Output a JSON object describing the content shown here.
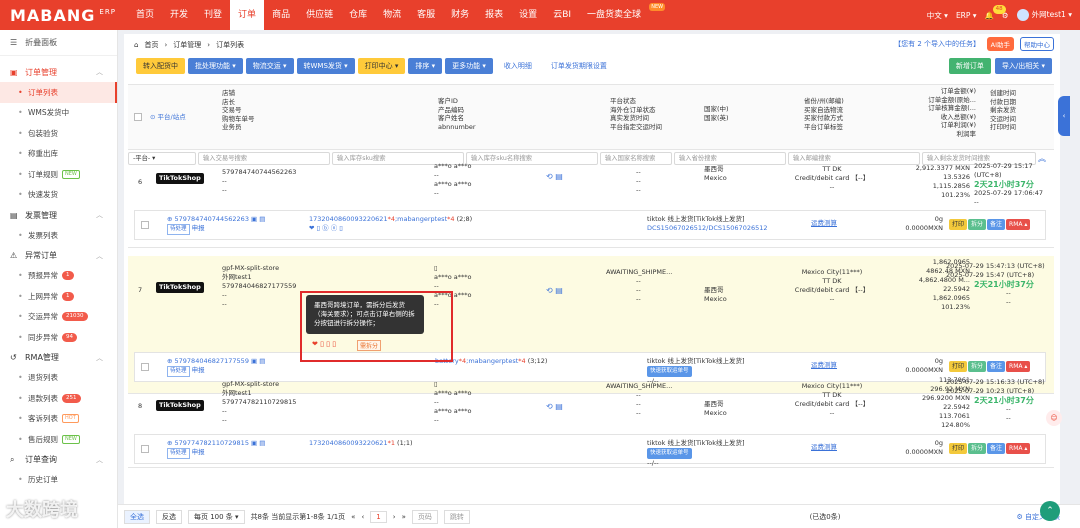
{
  "topnav": {
    "logo": "MABANG",
    "logo_sup": "ERP",
    "items": [
      "首页",
      "开发",
      "刊登",
      "订单",
      "商品",
      "供应链",
      "仓库",
      "物流",
      "客服",
      "财务",
      "报表",
      "设置",
      "云BI",
      "一盘货卖全球"
    ],
    "new_badge": "NEW",
    "lang": "中文",
    "erp_menu": "ERP",
    "bell_count": "48",
    "user": "外网test1"
  },
  "sidebar": {
    "collapse": "折叠面板",
    "groups": [
      {
        "title": "订单管理",
        "items": [
          {
            "label": "订单列表"
          },
          {
            "label": "WMS发货中"
          },
          {
            "label": "包装验货"
          },
          {
            "label": "称重出库"
          },
          {
            "label": "订单规则",
            "tag": "NEW"
          },
          {
            "label": "快速发货"
          }
        ]
      },
      {
        "title": "发票管理",
        "items": [
          {
            "label": "发票列表"
          }
        ]
      },
      {
        "title": "异常订单",
        "items": [
          {
            "label": "预报异常",
            "count": "1"
          },
          {
            "label": "上网异常",
            "count": "1"
          },
          {
            "label": "交运异常",
            "count": "21030"
          },
          {
            "label": "同步异常",
            "count": "94"
          }
        ]
      },
      {
        "title": "RMA管理",
        "items": [
          {
            "label": "退货列表"
          },
          {
            "label": "退款列表",
            "count": "251"
          },
          {
            "label": "客诉列表",
            "tag": "HOT"
          },
          {
            "label": "售后规则",
            "tag": "NEW"
          }
        ]
      },
      {
        "title": "订单查询",
        "items": [
          {
            "label": "历史订单"
          }
        ]
      }
    ]
  },
  "breadcrumb": [
    "首页",
    "订单管理",
    "订单列表"
  ],
  "task_link": "【您有 2 个导入中的任务】",
  "ai_btn": "AI助手",
  "help_btn": "帮助中心",
  "toolbar": {
    "buttons": [
      "转入配货中",
      "批处理功能 ▾",
      "物流交运 ▾",
      "转WMS发货 ▾",
      "打印中心 ▾",
      "排序 ▾",
      "更多功能 ▾"
    ],
    "links": [
      "收入明细",
      "订单发货期限设置"
    ],
    "right": [
      "新增订单",
      "导入/出相关 ▾"
    ]
  },
  "headers": {
    "platform": "平台/站点",
    "store_info": [
      "店铺",
      "店长",
      "交易号",
      "购物车单号",
      "业务员"
    ],
    "customer": [
      "客户ID",
      "产品编码",
      "客户姓名",
      "abnnumber"
    ],
    "status": [
      "平台状态",
      "海外仓订单状态",
      "真实发货时间",
      "平台指定交运时间"
    ],
    "country": [
      "国家(中)",
      "国家(英)"
    ],
    "address": [
      "省份/州(邮编)",
      "买家自选物流",
      "买家付款方式",
      "平台订单标签"
    ],
    "amounts": [
      "订单金额(¥)",
      "订单金额(原始...",
      "订单核算金额(...",
      "收入总额(¥)",
      "订单利润(¥)",
      "利润率"
    ],
    "times": [
      "创建时间",
      "付款日期",
      "剩余发货",
      "交运时间",
      "打印时间"
    ]
  },
  "filters": [
    "-平台-",
    "输入交易号搜索",
    "输入库存sku搜索",
    "输入库存sku名称搜索",
    "输入国家名称搜索",
    "输入省份搜索",
    "输入邮编搜索",
    "输入剩余发货时间搜索"
  ],
  "rows": [
    {
      "num": "6",
      "platform": "TikTokShop",
      "store": "",
      "user": "",
      "trade_no": "579784740744562263",
      "dash1": "--",
      "dash2": "--",
      "customer": [
        "a***o a***o",
        "--",
        "a***o a***o",
        "--"
      ],
      "status": [
        "--",
        "--",
        "--"
      ],
      "country_cn": "墨西哥",
      "country_en": "Mexico",
      "addr": [
        "TT DK",
        "Credit/debit card 【--】",
        "--"
      ],
      "amounts": [
        "2,912.3377 MXN",
        "13.5326",
        "1,115.2856",
        "101.23%"
      ],
      "times": [
        "2025-07-29 15:17 (UTC+8)",
        "2天21小时37分",
        "2025-07-29 17:06:47",
        "--"
      ],
      "sub": {
        "order": "579784740744562263",
        "label": "待处理",
        "apply": "申报",
        "sku": "1732040860093220621",
        "qty": "4",
        "sku2": "mabangerptest",
        "qty2": "4",
        "meta": "(2;8)",
        "ship": "tiktok 线上发货[TikTok线上发货]",
        "track": "DCS15067026512/DCS15067026512",
        "fee": "运费测算",
        "weight": "0g",
        "price": "0.0000MXN"
      }
    },
    {
      "num": "7",
      "platform": "TikTokShop",
      "store": "gpf-MX-split-store",
      "user": "外网test1",
      "trade_no": "579784046827177559",
      "dash1": "--",
      "dash2": "--",
      "customer": [
        "a***o a***o",
        "--",
        "a***o a***o",
        "--"
      ],
      "status": [
        "AWAITING_SHIPME...",
        "--",
        "--",
        "--"
      ],
      "country_cn": "墨西哥",
      "country_en": "Mexico",
      "addr": [
        "Mexico City(11***)",
        "TT DK",
        "Credit/debit card 【--】",
        "--"
      ],
      "amounts": [
        "1,862.0965",
        "4862.48 MXN",
        "4,862.4800 M...",
        "22.5942",
        "1,862.0965",
        "101.23%"
      ],
      "times": [
        "2025-07-29 15:47:13 (UTC+8)",
        "2025-07-29 15:47 (UTC+8)",
        "2天21小时37分",
        "--",
        "--"
      ],
      "sub": {
        "order": "579784046827177559",
        "label": "待处理",
        "apply": "申报",
        "sku": "battery",
        "qty": "4",
        "sku2": "mabangerptest",
        "qty2": "4",
        "meta": "(3;12)",
        "split": "需拆分",
        "ship": "tiktok 线上发货[TikTok线上发货]",
        "fast": "快速获取运单号",
        "track": "--/--",
        "fee": "运费测算",
        "weight": "0g",
        "price": "0.0000MXN"
      }
    },
    {
      "num": "8",
      "platform": "TikTokShop",
      "store": "gpf-MX-split-store",
      "user": "外网test1",
      "trade_no": "579774782110729815",
      "dash1": "--",
      "dash2": "--",
      "customer": [
        "a***o a***o",
        "--",
        "a***o a***o",
        "--"
      ],
      "status": [
        "AWAITING_SHIPME...",
        "--",
        "--",
        "--"
      ],
      "country_cn": "墨西哥",
      "country_en": "Mexico",
      "addr": [
        "Mexico City(11***)",
        "TT DK",
        "Credit/debit card 【--】",
        "--"
      ],
      "amounts": [
        "113.7061",
        "296.92 MXN",
        "296.9200 MXN",
        "22.5942",
        "113.7061",
        "124.80%"
      ],
      "times": [
        "2025-07-29 15:16:33 (UTC+8)",
        "2025-07-29 10:23 (UTC+8)",
        "2天21小时37分",
        "--",
        "--"
      ],
      "sub": {
        "order": "579774782110729815",
        "label": "待处理",
        "apply": "申报",
        "sku": "1732040860093220621",
        "qty": "1",
        "meta": "(1;1)",
        "ship": "tiktok 线上发货[TikTok线上发货]",
        "fast": "快速获取运单号",
        "track": "--/--",
        "fee": "运费测算",
        "weight": "0g",
        "price": "0.0000MXN"
      }
    }
  ],
  "row_buttons": [
    "打印",
    "拆分",
    "备注",
    "RMA ▴"
  ],
  "tooltip": "墨西哥跨境订单，需拆分后发货（海关要求）；可点击订单右侧的拆分按钮进行拆分操作；",
  "footer": {
    "select_all": "全选",
    "invert": "反选",
    "per_page": "每页 100 条 ▾",
    "summary": "共8条 当前显示第1-8条 1/1页",
    "page": "1",
    "jump_page": "页码",
    "jump": "跳转",
    "selected": "(已选0条)",
    "custom": "自定义列表"
  },
  "watermark": "大数跨境",
  "colors": {
    "brand": "#e8402c",
    "blue": "#3b72d8",
    "green": "#3bb56a"
  }
}
